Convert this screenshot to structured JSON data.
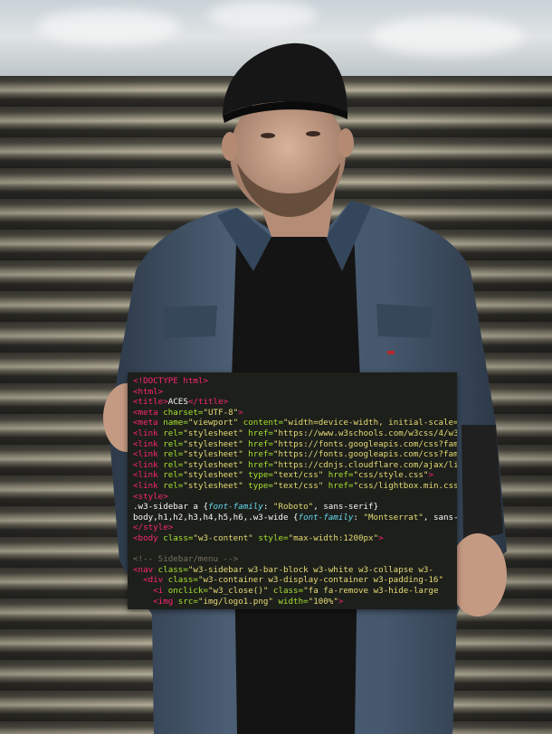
{
  "code_card": {
    "lines": [
      {
        "parts": [
          {
            "t": "<!DOCTYPE html>",
            "c": "tag"
          }
        ]
      },
      {
        "parts": [
          {
            "t": "<html>",
            "c": "tag"
          }
        ]
      },
      {
        "parts": [
          {
            "t": "<title>",
            "c": "tag"
          },
          {
            "t": "ACES",
            "c": "plain"
          },
          {
            "t": "</title>",
            "c": "tag"
          }
        ]
      },
      {
        "parts": [
          {
            "t": "<meta ",
            "c": "tag"
          },
          {
            "t": "charset=",
            "c": "attr"
          },
          {
            "t": "\"UTF-8\"",
            "c": "str"
          },
          {
            "t": ">",
            "c": "tag"
          }
        ]
      },
      {
        "parts": [
          {
            "t": "<meta ",
            "c": "tag"
          },
          {
            "t": "name=",
            "c": "attr"
          },
          {
            "t": "\"viewport\" ",
            "c": "str"
          },
          {
            "t": "content=",
            "c": "attr"
          },
          {
            "t": "\"width=device-width, initial-scale=1\"",
            "c": "str"
          }
        ]
      },
      {
        "parts": [
          {
            "t": "<link ",
            "c": "tag"
          },
          {
            "t": "rel=",
            "c": "attr"
          },
          {
            "t": "\"stylesheet\" ",
            "c": "str"
          },
          {
            "t": "href=",
            "c": "attr"
          },
          {
            "t": "\"https://www.w3schools.com/w3css/4/w3",
            "c": "str"
          }
        ]
      },
      {
        "parts": [
          {
            "t": "<link ",
            "c": "tag"
          },
          {
            "t": "rel=",
            "c": "attr"
          },
          {
            "t": "\"stylesheet\" ",
            "c": "str"
          },
          {
            "t": "href=",
            "c": "attr"
          },
          {
            "t": "\"https://fonts.googleapis.com/css?fam",
            "c": "str"
          }
        ]
      },
      {
        "parts": [
          {
            "t": "<link ",
            "c": "tag"
          },
          {
            "t": "rel=",
            "c": "attr"
          },
          {
            "t": "\"stylesheet\" ",
            "c": "str"
          },
          {
            "t": "href=",
            "c": "attr"
          },
          {
            "t": "\"https://fonts.googleapis.com/css?fam",
            "c": "str"
          }
        ]
      },
      {
        "parts": [
          {
            "t": "<link ",
            "c": "tag"
          },
          {
            "t": "rel=",
            "c": "attr"
          },
          {
            "t": "\"stylesheet\" ",
            "c": "str"
          },
          {
            "t": "href=",
            "c": "attr"
          },
          {
            "t": "\"https://cdnjs.cloudflare.com/ajax/lib",
            "c": "str"
          }
        ]
      },
      {
        "parts": [
          {
            "t": "<link ",
            "c": "tag"
          },
          {
            "t": "rel=",
            "c": "attr"
          },
          {
            "t": "\"stylesheet\" ",
            "c": "str"
          },
          {
            "t": "type=",
            "c": "attr"
          },
          {
            "t": "\"text/css\" ",
            "c": "str"
          },
          {
            "t": "href=",
            "c": "attr"
          },
          {
            "t": "\"css/style.css\"",
            "c": "str"
          },
          {
            "t": ">",
            "c": "tag"
          }
        ]
      },
      {
        "parts": [
          {
            "t": "<link ",
            "c": "tag"
          },
          {
            "t": "rel=",
            "c": "attr"
          },
          {
            "t": "\"stylesheet\" ",
            "c": "str"
          },
          {
            "t": "type=",
            "c": "attr"
          },
          {
            "t": "\"text/css\" ",
            "c": "str"
          },
          {
            "t": "href=",
            "c": "attr"
          },
          {
            "t": "\"css/lightbox.min.css\"",
            "c": "str"
          }
        ]
      },
      {
        "parts": [
          {
            "t": "<style>",
            "c": "tag"
          }
        ]
      },
      {
        "parts": [
          {
            "t": ".w3-sidebar a {",
            "c": "plain"
          },
          {
            "t": "font-family",
            "c": "prop"
          },
          {
            "t": ": ",
            "c": "plain"
          },
          {
            "t": "\"Roboto\"",
            "c": "str"
          },
          {
            "t": ", sans-serif}",
            "c": "plain"
          }
        ]
      },
      {
        "parts": [
          {
            "t": "body,h1,h2,h3,h4,h5,h6,.w3-wide {",
            "c": "plain"
          },
          {
            "t": "font-family",
            "c": "prop"
          },
          {
            "t": ": ",
            "c": "plain"
          },
          {
            "t": "\"Montserrat\"",
            "c": "str"
          },
          {
            "t": ", sans-s",
            "c": "plain"
          }
        ]
      },
      {
        "parts": [
          {
            "t": "</style>",
            "c": "tag"
          }
        ]
      },
      {
        "parts": [
          {
            "t": "<body ",
            "c": "tag"
          },
          {
            "t": "class=",
            "c": "attr"
          },
          {
            "t": "\"w3-content\" ",
            "c": "str"
          },
          {
            "t": "style=",
            "c": "attr"
          },
          {
            "t": "\"max-width:1200px\"",
            "c": "str"
          },
          {
            "t": ">",
            "c": "tag"
          }
        ]
      },
      {
        "parts": [
          {
            "t": "",
            "c": "plain"
          }
        ]
      },
      {
        "parts": [
          {
            "t": "<!-- Sidebar/menu -->",
            "c": "comment"
          }
        ]
      },
      {
        "parts": [
          {
            "t": "<nav ",
            "c": "tag"
          },
          {
            "t": "class=",
            "c": "attr"
          },
          {
            "t": "\"w3-sidebar w3-bar-block w3-white w3-collapse w3-",
            "c": "str"
          }
        ]
      },
      {
        "parts": [
          {
            "t": "  <div ",
            "c": "tag"
          },
          {
            "t": "class=",
            "c": "attr"
          },
          {
            "t": "\"w3-container w3-display-container w3-padding-16\"",
            "c": "str"
          }
        ]
      },
      {
        "parts": [
          {
            "t": "    <i ",
            "c": "tag"
          },
          {
            "t": "onclick=",
            "c": "attr"
          },
          {
            "t": "\"w3_close()\" ",
            "c": "str"
          },
          {
            "t": "class=",
            "c": "attr"
          },
          {
            "t": "\"fa fa-remove w3-hide-large",
            "c": "str"
          }
        ]
      },
      {
        "parts": [
          {
            "t": "    <img ",
            "c": "tag"
          },
          {
            "t": "src=",
            "c": "attr"
          },
          {
            "t": "\"img/logo1.png\" ",
            "c": "str"
          },
          {
            "t": "width=",
            "c": "attr"
          },
          {
            "t": "\"100%\"",
            "c": "str"
          },
          {
            "t": ">",
            "c": "tag"
          }
        ]
      }
    ]
  },
  "colors": {
    "code_background": "#1d1f1b",
    "tag": "#f92672",
    "attr": "#a6e22e",
    "string": "#e6db74",
    "comment": "#75715e",
    "jacket": "#3f5064",
    "cap": "#161616"
  }
}
